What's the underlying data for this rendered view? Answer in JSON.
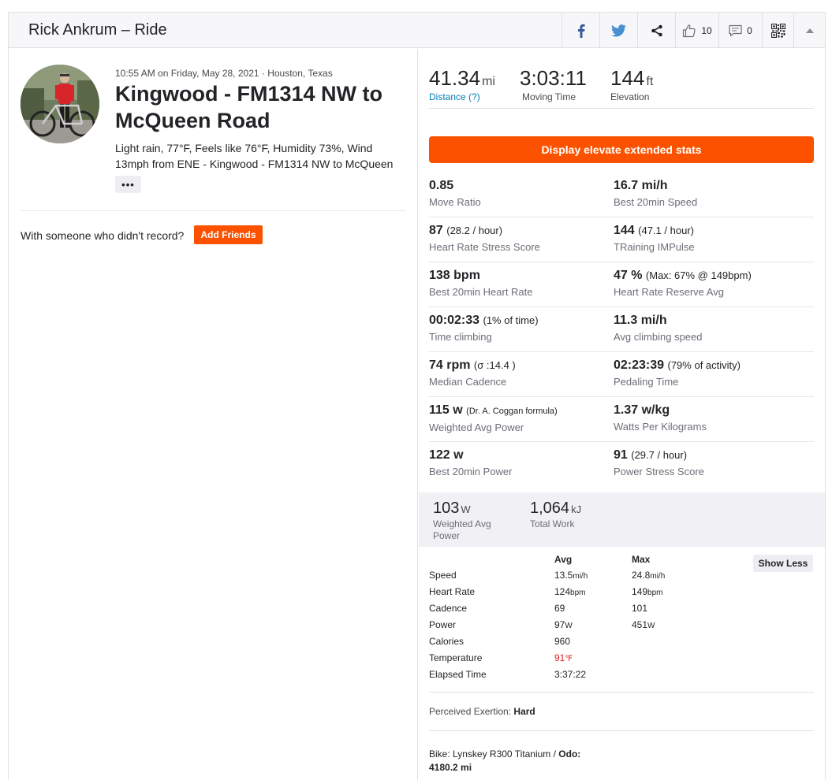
{
  "header": {
    "title": "Rick Ankrum – Ride",
    "kudos_count": "10",
    "comment_count": "0"
  },
  "activity": {
    "meta": "10:55 AM on Friday, May 28, 2021 · Houston, Texas",
    "title": "Kingwood - FM1314 NW to McQueen Road",
    "weather": "Light rain, 77°F, Feels like 76°F, Humidity 73%, Wind 13mph from ENE - Kingwood - FM1314 NW to McQueen",
    "more_label": "•••"
  },
  "friends": {
    "prompt": "With someone who didn't record?",
    "button": "Add Friends"
  },
  "top_stats": [
    {
      "value": "41.34",
      "unit": "mi",
      "label": "Distance (?)"
    },
    {
      "value": "3:03:11",
      "unit": "",
      "label": "Moving Time"
    },
    {
      "value": "144",
      "unit": "ft",
      "label": "Elevation"
    }
  ],
  "elevate_button": "Display elevate extended stats",
  "extended": [
    [
      {
        "value": "0.85",
        "sub": "",
        "label": "Move Ratio"
      },
      {
        "value": "16.7 mi/h",
        "sub": "",
        "label": "Best 20min Speed"
      }
    ],
    [
      {
        "value": "87",
        "sub": "(28.2 / hour)",
        "label": "Heart Rate Stress Score"
      },
      {
        "value": "144",
        "sub": "(47.1 / hour)",
        "label": "TRaining IMPulse"
      }
    ],
    [
      {
        "value": "138 bpm",
        "sub": "",
        "label": "Best 20min Heart Rate"
      },
      {
        "value": "47 %",
        "sub": "(Max: 67% @ 149bpm)",
        "label": "Heart Rate Reserve Avg"
      }
    ],
    [
      {
        "value": "00:02:33",
        "sub": "(1% of time)",
        "label": "Time climbing"
      },
      {
        "value": "11.3 mi/h",
        "sub": "",
        "label": "Avg climbing speed"
      }
    ],
    [
      {
        "value": "74 rpm",
        "sub": "(σ :14.4 )",
        "label": "Median Cadence"
      },
      {
        "value": "02:23:39",
        "sub": "(79% of activity)",
        "label": "Pedaling Time"
      }
    ],
    [
      {
        "value": "115 w",
        "sub": "(Dr. A. Coggan formula)",
        "label": "Weighted Avg Power"
      },
      {
        "value": "1.37 w/kg",
        "sub": "",
        "label": "Watts Per Kilograms"
      }
    ],
    [
      {
        "value": "122 w",
        "sub": "",
        "label": "Best 20min Power"
      },
      {
        "value": "91",
        "sub": "(29.7 / hour)",
        "label": "Power Stress Score"
      }
    ]
  ],
  "power_band": [
    {
      "value": "103",
      "unit": "W",
      "label_line1": "Weighted Avg",
      "label_line2": "Power"
    },
    {
      "value": "1,064",
      "unit": "kJ",
      "label_line1": "Total Work",
      "label_line2": ""
    }
  ],
  "table": {
    "headers": {
      "avg": "Avg",
      "max": "Max"
    },
    "show_less": "Show Less",
    "rows": [
      {
        "name": "Speed",
        "avg": "13.5",
        "avg_unit": "mi/h",
        "max": "24.8",
        "max_unit": "mi/h"
      },
      {
        "name": "Heart Rate",
        "avg": "124",
        "avg_unit": "bpm",
        "max": "149",
        "max_unit": "bpm"
      },
      {
        "name": "Cadence",
        "avg": "69",
        "avg_unit": "",
        "max": "101",
        "max_unit": ""
      },
      {
        "name": "Power",
        "avg": "97",
        "avg_unit": "W",
        "max": "451",
        "max_unit": "W"
      },
      {
        "name": "Calories",
        "avg": "960",
        "avg_unit": "",
        "max": "",
        "max_unit": ""
      },
      {
        "name": "Temperature",
        "avg": "91",
        "avg_unit": "℉",
        "max": "",
        "max_unit": ""
      },
      {
        "name": "Elapsed Time",
        "avg": "3:37:22",
        "avg_unit": "",
        "max": "",
        "max_unit": ""
      }
    ]
  },
  "perceived": {
    "label": "Perceived Exertion:",
    "value": "Hard"
  },
  "bike": {
    "label": "Bike: Lynskey R300 Titanium / ",
    "odo_label": "Odo:",
    "odo_value": "4180.2 mi"
  },
  "colors": {
    "accent": "#fc5200",
    "link": "#007fb6",
    "temperature": "#e31f1f"
  }
}
